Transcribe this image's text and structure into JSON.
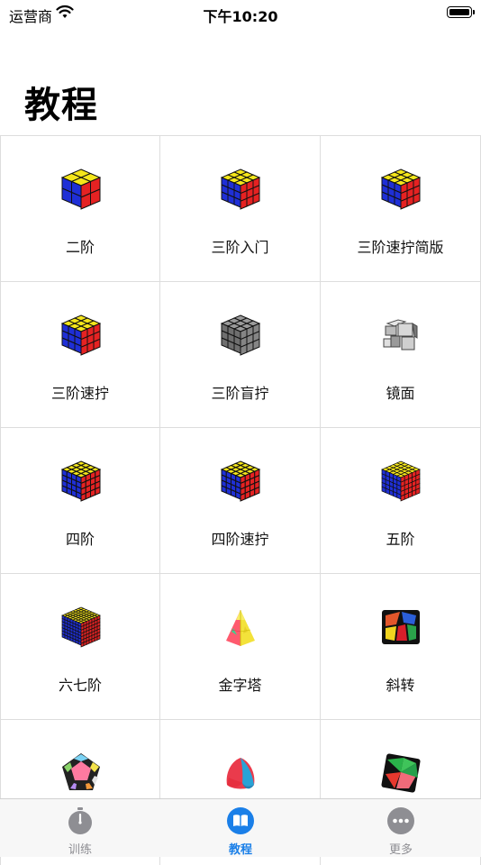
{
  "status_bar": {
    "carrier": "运营商",
    "time": "下午10:20"
  },
  "header": {
    "title": "教程"
  },
  "items": [
    {
      "label": "二阶",
      "icon": "cube-2x2-icon"
    },
    {
      "label": "三阶入门",
      "icon": "cube-3x3-icon"
    },
    {
      "label": "三阶速拧简版",
      "icon": "cube-3x3-icon"
    },
    {
      "label": "三阶速拧",
      "icon": "cube-3x3-icon"
    },
    {
      "label": "三阶盲拧",
      "icon": "gray-cube-icon"
    },
    {
      "label": "镜面",
      "icon": "mirror-cube-icon"
    },
    {
      "label": "四阶",
      "icon": "cube-4x4-icon"
    },
    {
      "label": "四阶速拧",
      "icon": "cube-4x4-icon"
    },
    {
      "label": "五阶",
      "icon": "cube-5x5-icon"
    },
    {
      "label": "六七阶",
      "icon": "cube-7x7-icon"
    },
    {
      "label": "金字塔",
      "icon": "pyramid-icon"
    },
    {
      "label": "斜转",
      "icon": "skewb-icon"
    },
    {
      "label": "",
      "icon": "megaminx-icon"
    },
    {
      "label": "",
      "icon": "mastermorphix-icon"
    },
    {
      "label": "",
      "icon": "square-one-icon"
    }
  ],
  "tab_bar": {
    "tabs": [
      {
        "label": "训练",
        "icon": "stopwatch-icon",
        "active": false
      },
      {
        "label": "教程",
        "icon": "book-icon",
        "active": true
      },
      {
        "label": "更多",
        "icon": "more-icon",
        "active": false
      }
    ]
  },
  "colors": {
    "accent": "#1a7fe8",
    "inactive": "#8e8e93",
    "cube_top": "#f5e61a",
    "cube_left": "#1f2fd6",
    "cube_right": "#e52222"
  }
}
